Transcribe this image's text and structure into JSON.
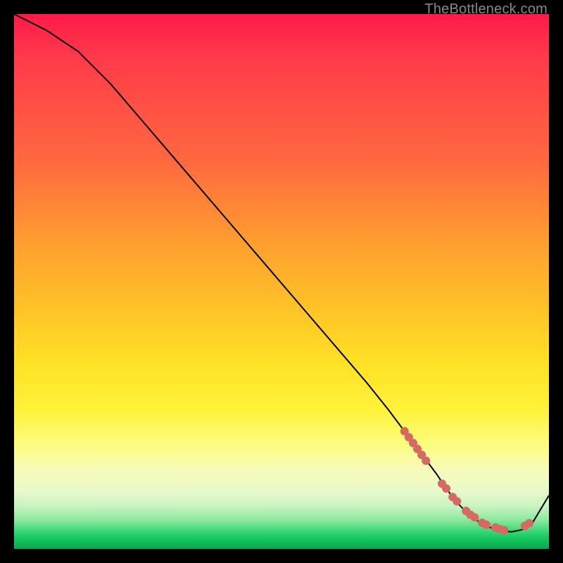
{
  "watermark": "TheBottleneck.com",
  "colors": {
    "curve": "#000000",
    "dot": "#d46a62",
    "gradient_top": "#ff1a4a",
    "gradient_mid": "#ffe326",
    "gradient_bottom": "#0aa84e"
  },
  "chart_data": {
    "type": "line",
    "title": "",
    "xlabel": "",
    "ylabel": "",
    "xlim": [
      0,
      100
    ],
    "ylim": [
      0,
      100
    ],
    "grid": false,
    "legend": false,
    "axes_visible": false,
    "series": [
      {
        "name": "bottleneck-curve",
        "x": [
          0,
          6,
          12,
          18,
          24,
          30,
          36,
          42,
          48,
          54,
          60,
          66,
          70,
          73,
          76,
          79,
          81,
          83,
          85,
          87,
          89,
          91,
          93,
          95,
          97,
          100
        ],
        "y": [
          100,
          97,
          93,
          87,
          80,
          73,
          66,
          59,
          52,
          45,
          38,
          31,
          26,
          22,
          18,
          14,
          11,
          8.5,
          6.4,
          5.0,
          4.0,
          3.4,
          3.2,
          3.6,
          5.0,
          10
        ]
      }
    ],
    "highlight_points": {
      "name": "optimal-range-dots",
      "x": [
        73.0,
        73.8,
        74.6,
        75.4,
        76.2,
        77.0,
        80.0,
        80.8,
        82.0,
        82.8,
        84.5,
        85.3,
        86.1,
        87.5,
        88.3,
        90.0,
        90.8,
        91.6,
        95.5,
        96.3
      ],
      "y": [
        22.0,
        20.9,
        19.8,
        18.7,
        17.6,
        16.5,
        12.2,
        11.3,
        9.7,
        8.9,
        7.1,
        6.4,
        5.9,
        4.9,
        4.5,
        4.0,
        3.7,
        3.5,
        4.3,
        4.8
      ]
    }
  }
}
